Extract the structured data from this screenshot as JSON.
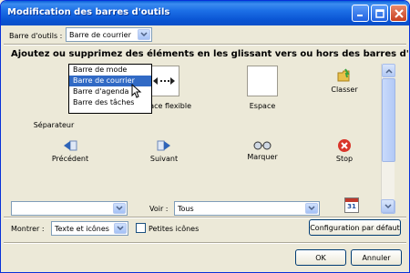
{
  "window": {
    "title": "Modification des barres d'outils"
  },
  "toolbar_select": {
    "label": "Barre d'outils :",
    "value": "Barre de courrier"
  },
  "dropdown": {
    "options": [
      "Barre de mode",
      "Barre de courrier",
      "Barre d'agenda",
      "Barre des tâches"
    ],
    "selected_index": 1
  },
  "instruction": "Ajoutez ou supprimez des éléments en les glissant vers ou hors des barres d'outils.",
  "palette": {
    "items": [
      {
        "label": "Séparateur",
        "icon": "separator-icon"
      },
      {
        "label": "Espace flexible",
        "icon": "flexible-space-icon"
      },
      {
        "label": "Espace",
        "icon": "space-icon"
      },
      {
        "label": "Classer",
        "icon": "file-folder-icon"
      },
      {
        "label": "Précédent",
        "icon": "previous-icon"
      },
      {
        "label": "Suivant",
        "icon": "next-icon"
      },
      {
        "label": "Marquer",
        "icon": "mark-glasses-icon"
      },
      {
        "label": "Stop",
        "icon": "stop-icon"
      }
    ]
  },
  "bottom_bar": {
    "left_combo_value": "",
    "voir_label": "Voir :",
    "voir_value": "Tous",
    "calendar_day": "31"
  },
  "show": {
    "label": "Montrer :",
    "value": "Texte et icônes",
    "small_icons_label": "Petites icônes",
    "small_icons_checked": false
  },
  "buttons": {
    "default_config": "Configuration par défaut",
    "ok": "OK",
    "cancel": "Annuler"
  },
  "colors": {
    "titlebar": "#0a5fd8",
    "selection": "#316ac5",
    "close": "#c84020"
  }
}
